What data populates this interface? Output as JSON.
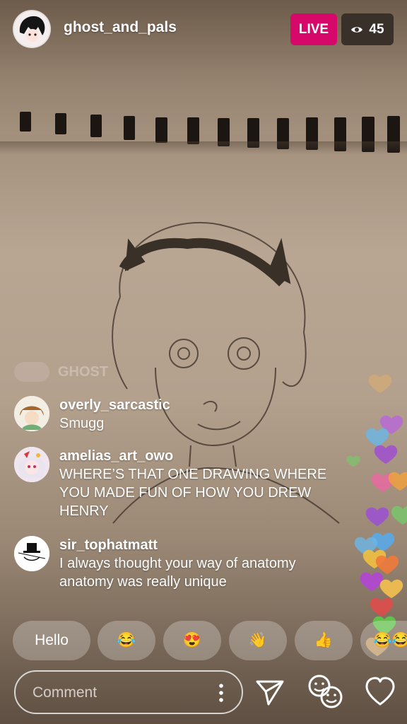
{
  "header": {
    "username": "ghost_and_pals",
    "live_label": "LIVE",
    "viewer_count": "45"
  },
  "faded_comment": {
    "username": "GHOST"
  },
  "comments": [
    {
      "username": "overly_sarcastic",
      "text": "Smugg"
    },
    {
      "username": "amelias_art_owo",
      "text": "WHERE’S THAT ONE DRAWING WHERE YOU MADE FUN OF HOW YOU DREW HENRY"
    },
    {
      "username": "sir_tophatmatt",
      "text": "I always thought your way of anatomy anatomy was really unique"
    }
  ],
  "quick_replies": [
    "Hello",
    "😂",
    "😍",
    "👋",
    "👍",
    "😂😂"
  ],
  "composer": {
    "placeholder": "Comment"
  },
  "colors": {
    "live": "#d6086a",
    "viewer_badge": "#3a302a"
  },
  "icons": [
    "eye-icon",
    "more-options-icon",
    "send-icon",
    "face-filter-icon",
    "heart-icon"
  ]
}
